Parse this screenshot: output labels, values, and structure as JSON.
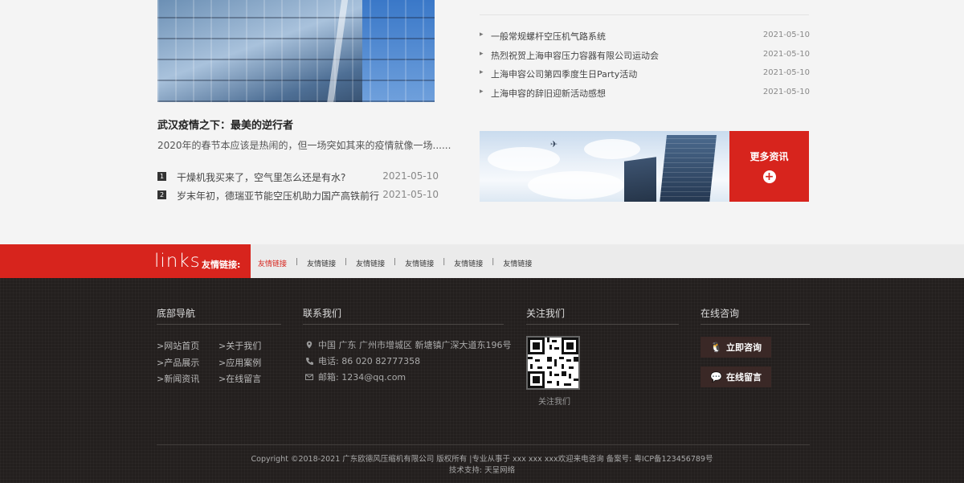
{
  "feature": {
    "title": "武汉疫情之下：最美的逆行者",
    "desc": "2020年的春节本应该是热闹的，但一场突如其来的疫情就像一场......"
  },
  "left_news": [
    {
      "num": "1",
      "title": "干燥机我买来了，空气里怎么还是有水?",
      "date": "2021-05-10"
    },
    {
      "num": "2",
      "title": "岁末年初，德瑞亚节能空压机助力国产高铁前行",
      "date": "2021-05-10"
    }
  ],
  "right_news": [
    {
      "title": "一般常规螺杆空压机气路系统",
      "date": "2021-05-10"
    },
    {
      "title": "热烈祝贺上海申容压力容器有限公司运动会",
      "date": "2021-05-10"
    },
    {
      "title": "上海申容公司第四季度生日Party活动",
      "date": "2021-05-10"
    },
    {
      "title": "上海申容的辞旧迎新活动感想",
      "date": "2021-05-10"
    }
  ],
  "more": {
    "label": "更多资讯",
    "plus": "+"
  },
  "links": {
    "word": "links",
    "sub": "友情链接:",
    "items": [
      "友情链接",
      "友情链接",
      "友情链接",
      "友情链接",
      "友情链接",
      "友情链接"
    ],
    "sep": "|"
  },
  "footer": {
    "nav_title": "底部导航",
    "nav_items": [
      ">网站首页",
      ">关于我们",
      ">产品展示",
      ">应用案例",
      ">新闻资讯",
      ">在线留言"
    ],
    "contact_title": "联系我们",
    "address": "中国 广东 广州市增城区 新塘镇广深大道东196号",
    "phone": "电话: 86 020 82777358",
    "email": "邮箱: 1234@qq.com",
    "follow_title": "关注我们",
    "qr_label": "关注我们",
    "consult_title": "在线咨询",
    "consult_btn": "立即咨询",
    "message_btn": "在线留言",
    "copyright_line1": "Copyright ©2018-2021 广东欧德风压缩机有限公司 版权所有 |专业从事于 xxx xxx xxx欢迎来电咨询 备案号: 粤ICP备123456789号",
    "copyright_line2": "技术支持: 天呈网络"
  },
  "colors": {
    "accent": "#d7241d",
    "footer_bg": "#231f1e",
    "bar_bg": "#ebebeb"
  },
  "icons": [
    "location-icon",
    "phone-icon",
    "mail-icon",
    "qq-icon",
    "message-icon",
    "plus-icon",
    "airplane-icon"
  ]
}
